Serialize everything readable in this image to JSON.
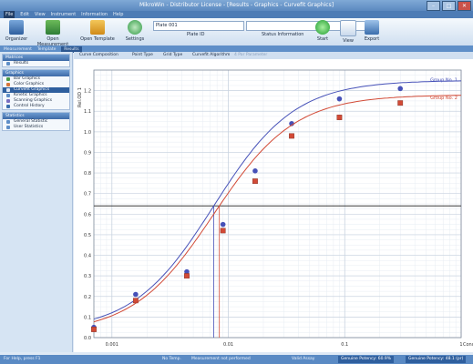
{
  "window": {
    "title": "MikroWin - Distributor License - [Results - Graphics - Curvefit Graphics]"
  },
  "menu": [
    "File",
    "Edit",
    "View",
    "Instrument",
    "Information",
    "Help"
  ],
  "ribbon": {
    "organizer": "Organizer",
    "open_measurement": "Open Measurement",
    "open_template": "Open Template",
    "settings": "Settings",
    "plate_id_value": "Plate 001",
    "plate_id_label": "Plate ID",
    "status_label": "Status Information",
    "start": "Start",
    "view": "View",
    "export": "Export"
  },
  "tabs": [
    "Measurement",
    "Template",
    "Results"
  ],
  "left": {
    "sec_matrices": "Matrices",
    "results": "Results",
    "sec_graphics": "Graphics",
    "graphics_items": [
      "Bar Graphics",
      "Color Graphics",
      "Curvefit Graphics",
      "Kinetic Graphics",
      "Scanning Graphics",
      "Control History"
    ],
    "sec_statistics": "Statistics",
    "stats_items": [
      "General Statistic",
      "User Statistics"
    ]
  },
  "chart_toolbar": {
    "curve": "Curve Composition",
    "point": "Point Type",
    "grid": "Grid Type",
    "alg": "Curvefit Algorithm",
    "param": "4 Par Parameter"
  },
  "status": {
    "help": "For Help, press F1",
    "nofile": "No Temp.",
    "meas": "Measurement not performed",
    "valid": "Valid Assay",
    "genuine1": "Genuine Potency: 60.9%",
    "genuine2": "Genuine Potency: 48.1 (pr)"
  },
  "colors": {
    "series1": "#4651b8",
    "series2": "#d24a36",
    "threshold": "#3a3a3a"
  },
  "chart_data": {
    "type": "scatter",
    "title": "",
    "xlabel": "Conc.",
    "ylabel": "Rel.OD 1",
    "xscale": "log",
    "xlim": [
      0.0007,
      1.0
    ],
    "ylim": [
      0,
      1.3
    ],
    "yticks": [
      0,
      0.1,
      0.2,
      0.3,
      0.4,
      0.5,
      0.6,
      0.7,
      0.8,
      0.9,
      1.0,
      1.1,
      1.2
    ],
    "xticks": [
      {
        "x": 0.001,
        "label": "0.001"
      },
      {
        "x": 0.01,
        "label": "0.01"
      },
      {
        "x": 0.1,
        "label": "0.1"
      },
      {
        "x": 1,
        "label": "1"
      }
    ],
    "threshold": 0.64,
    "series": [
      {
        "name": "Group No. 1",
        "marker": "circle",
        "color": "#4651b8",
        "x": [
          0.0007,
          0.0016,
          0.0044,
          0.009,
          0.017,
          0.035,
          0.09,
          0.3
        ],
        "y": [
          0.05,
          0.21,
          0.32,
          0.55,
          0.81,
          1.04,
          1.16,
          1.21
        ]
      },
      {
        "name": "Group No. 2",
        "marker": "square",
        "color": "#d24a36",
        "x": [
          0.0007,
          0.0016,
          0.0044,
          0.009,
          0.017,
          0.035,
          0.09,
          0.3
        ],
        "y": [
          0.04,
          0.18,
          0.3,
          0.52,
          0.76,
          0.98,
          1.07,
          1.14
        ]
      }
    ],
    "series_labels": [
      "Group No. 1",
      "Group No. 2"
    ]
  }
}
